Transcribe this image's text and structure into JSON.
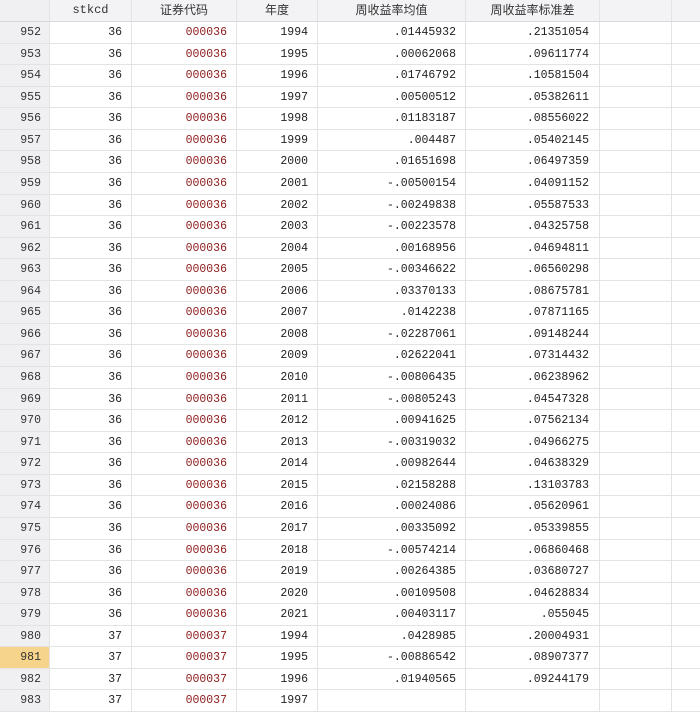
{
  "columns": [
    "stkcd",
    "证券代码",
    "年度",
    "周收益率均值",
    "周收益率标准差"
  ],
  "selected_row": 981,
  "rows": [
    [
      "952",
      "36",
      "000036",
      "1994",
      ".01445932",
      ".21351054"
    ],
    [
      "953",
      "36",
      "000036",
      "1995",
      ".00062068",
      ".09611774"
    ],
    [
      "954",
      "36",
      "000036",
      "1996",
      ".01746792",
      ".10581504"
    ],
    [
      "955",
      "36",
      "000036",
      "1997",
      ".00500512",
      ".05382611"
    ],
    [
      "956",
      "36",
      "000036",
      "1998",
      ".01183187",
      ".08556022"
    ],
    [
      "957",
      "36",
      "000036",
      "1999",
      ".004487",
      ".05402145"
    ],
    [
      "958",
      "36",
      "000036",
      "2000",
      ".01651698",
      ".06497359"
    ],
    [
      "959",
      "36",
      "000036",
      "2001",
      "-.00500154",
      ".04091152"
    ],
    [
      "960",
      "36",
      "000036",
      "2002",
      "-.00249838",
      ".05587533"
    ],
    [
      "961",
      "36",
      "000036",
      "2003",
      "-.00223578",
      ".04325758"
    ],
    [
      "962",
      "36",
      "000036",
      "2004",
      ".00168956",
      ".04694811"
    ],
    [
      "963",
      "36",
      "000036",
      "2005",
      "-.00346622",
      ".06560298"
    ],
    [
      "964",
      "36",
      "000036",
      "2006",
      ".03370133",
      ".08675781"
    ],
    [
      "965",
      "36",
      "000036",
      "2007",
      ".0142238",
      ".07871165"
    ],
    [
      "966",
      "36",
      "000036",
      "2008",
      "-.02287061",
      ".09148244"
    ],
    [
      "967",
      "36",
      "000036",
      "2009",
      ".02622041",
      ".07314432"
    ],
    [
      "968",
      "36",
      "000036",
      "2010",
      "-.00806435",
      ".06238962"
    ],
    [
      "969",
      "36",
      "000036",
      "2011",
      "-.00805243",
      ".04547328"
    ],
    [
      "970",
      "36",
      "000036",
      "2012",
      ".00941625",
      ".07562134"
    ],
    [
      "971",
      "36",
      "000036",
      "2013",
      "-.00319032",
      ".04966275"
    ],
    [
      "972",
      "36",
      "000036",
      "2014",
      ".00982644",
      ".04638329"
    ],
    [
      "973",
      "36",
      "000036",
      "2015",
      ".02158288",
      ".13103783"
    ],
    [
      "974",
      "36",
      "000036",
      "2016",
      ".00024086",
      ".05620961"
    ],
    [
      "975",
      "36",
      "000036",
      "2017",
      ".00335092",
      ".05339855"
    ],
    [
      "976",
      "36",
      "000036",
      "2018",
      "-.00574214",
      ".06860468"
    ],
    [
      "977",
      "36",
      "000036",
      "2019",
      ".00264385",
      ".03680727"
    ],
    [
      "978",
      "36",
      "000036",
      "2020",
      ".00109508",
      ".04628834"
    ],
    [
      "979",
      "36",
      "000036",
      "2021",
      ".00403117",
      ".055045"
    ],
    [
      "980",
      "37",
      "000037",
      "1994",
      ".0428985",
      ".20004931"
    ],
    [
      "981",
      "37",
      "000037",
      "1995",
      "-.00886542",
      ".08907377"
    ],
    [
      "982",
      "37",
      "000037",
      "1996",
      ".01940565",
      ".09244179"
    ],
    [
      "983",
      "37",
      "000037",
      "1997",
      "",
      ""
    ]
  ]
}
